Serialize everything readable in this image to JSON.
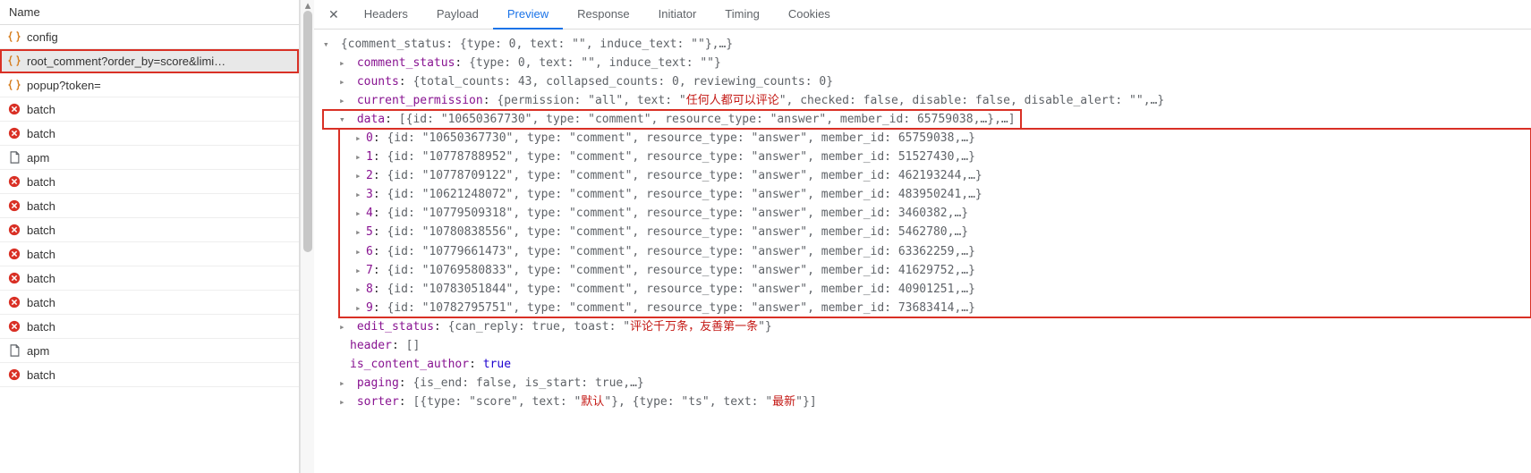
{
  "leftPanel": {
    "header": "Name",
    "requests": [
      {
        "icon": "json",
        "name": "config",
        "selected": false
      },
      {
        "icon": "json",
        "name": "root_comment?order_by=score&limi…",
        "selected": true
      },
      {
        "icon": "json",
        "name": "popup?token=",
        "selected": false
      },
      {
        "icon": "error",
        "name": "batch",
        "selected": false
      },
      {
        "icon": "error",
        "name": "batch",
        "selected": false
      },
      {
        "icon": "doc",
        "name": "apm",
        "selected": false
      },
      {
        "icon": "error",
        "name": "batch",
        "selected": false
      },
      {
        "icon": "error",
        "name": "batch",
        "selected": false
      },
      {
        "icon": "error",
        "name": "batch",
        "selected": false
      },
      {
        "icon": "error",
        "name": "batch",
        "selected": false
      },
      {
        "icon": "error",
        "name": "batch",
        "selected": false
      },
      {
        "icon": "error",
        "name": "batch",
        "selected": false
      },
      {
        "icon": "error",
        "name": "batch",
        "selected": false
      },
      {
        "icon": "doc",
        "name": "apm",
        "selected": false
      },
      {
        "icon": "error",
        "name": "batch",
        "selected": false
      }
    ]
  },
  "tabs": {
    "items": [
      "Headers",
      "Payload",
      "Preview",
      "Response",
      "Initiator",
      "Timing",
      "Cookies"
    ],
    "active": "Preview"
  },
  "preview": {
    "rootSummary": "{comment_status: {type: 0, text: \"\", induce_text: \"\"},…}",
    "comment_status": {
      "key": "comment_status",
      "summary": "{type: 0, text: \"\", induce_text: \"\"}"
    },
    "counts": {
      "key": "counts",
      "summary": "{total_counts: 43, collapsed_counts: 0, reviewing_counts: 0}"
    },
    "current_permission": {
      "key": "current_permission",
      "summary_pre": "{permission: \"all\", text: \"",
      "summary_cjk": "任何人都可以评论",
      "summary_post": "\", checked: false, disable: false, disable_alert: \"\",…}"
    },
    "data": {
      "key": "data",
      "summary": "[{id: \"10650367730\", type: \"comment\", resource_type: \"answer\", member_id: 65759038,…},…]",
      "items": [
        {
          "idx": "0",
          "id": "10650367730",
          "type": "comment",
          "resource_type": "answer",
          "member_id": "65759038"
        },
        {
          "idx": "1",
          "id": "10778788952",
          "type": "comment",
          "resource_type": "answer",
          "member_id": "51527430"
        },
        {
          "idx": "2",
          "id": "10778709122",
          "type": "comment",
          "resource_type": "answer",
          "member_id": "462193244"
        },
        {
          "idx": "3",
          "id": "10621248072",
          "type": "comment",
          "resource_type": "answer",
          "member_id": "483950241"
        },
        {
          "idx": "4",
          "id": "10779509318",
          "type": "comment",
          "resource_type": "answer",
          "member_id": "3460382"
        },
        {
          "idx": "5",
          "id": "10780838556",
          "type": "comment",
          "resource_type": "answer",
          "member_id": "5462780"
        },
        {
          "idx": "6",
          "id": "10779661473",
          "type": "comment",
          "resource_type": "answer",
          "member_id": "63362259"
        },
        {
          "idx": "7",
          "id": "10769580833",
          "type": "comment",
          "resource_type": "answer",
          "member_id": "41629752"
        },
        {
          "idx": "8",
          "id": "10783051844",
          "type": "comment",
          "resource_type": "answer",
          "member_id": "40901251"
        },
        {
          "idx": "9",
          "id": "10782795751",
          "type": "comment",
          "resource_type": "answer",
          "member_id": "73683414"
        }
      ]
    },
    "edit_status": {
      "key": "edit_status",
      "summary_pre": "{can_reply: true, toast: \"",
      "summary_cjk": "评论千万条，友善第一条",
      "summary_post": "\"}"
    },
    "header_prop": {
      "key": "header",
      "summary": "[]"
    },
    "is_content_author": {
      "key": "is_content_author",
      "value": "true"
    },
    "paging": {
      "key": "paging",
      "summary": "{is_end: false, is_start: true,…}"
    },
    "sorter": {
      "key": "sorter",
      "summary_pre": "[{type: \"score\", text: \"",
      "summary_cjk1": "默认",
      "summary_mid": "\"}, {type: \"ts\", text: \"",
      "summary_cjk2": "最新",
      "summary_post": "\"}]"
    }
  }
}
